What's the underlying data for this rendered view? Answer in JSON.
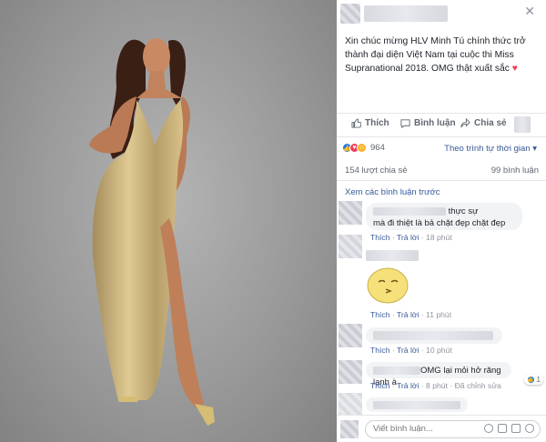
{
  "post": {
    "text": "Xin chúc mừng HLV Minh Tú chính thức trở thành đại diện Việt Nam tại cuộc thi Miss Supranational 2018. OMG thật xuất sắc ",
    "heart": "♥"
  },
  "actions": {
    "like": "Thích",
    "comment": "Bình luận",
    "share": "Chia sẻ"
  },
  "reactions": {
    "count": "964",
    "sort_label": "Theo trình tự thời gian ▾"
  },
  "stats": {
    "shares": "154 lượt chia sẻ",
    "comments": "99 bình luận"
  },
  "view_more": "Xem các bình luận trước",
  "comments": [
    {
      "text_after_blur": "thực sự",
      "text_line2": "mà đi thiệt là bả chặt đẹp chặt đẹp",
      "like": "Thích",
      "reply": "Trả lời",
      "time": "18 phút"
    },
    {
      "like": "Thích",
      "reply": "Trả lời",
      "time": "11 phút"
    },
    {
      "like": "Thích",
      "reply": "Trả lời",
      "time": "10 phút"
    },
    {
      "text_after_blur": "OMG lại mỏi hở răng lạnh à",
      "like": "Thích",
      "reply": "Trả lời",
      "time": "8 phút",
      "edited": "Đã chỉnh sửa",
      "reaction_count": "1"
    }
  ],
  "input": {
    "placeholder": "Viết bình luận..."
  },
  "colors": {
    "link": "#385898",
    "text": "#1d2129",
    "muted": "#606770",
    "like_blue": "#1877f2",
    "love_red": "#f33e58",
    "haha_yellow": "#f7b125"
  },
  "icons": [
    "close-icon",
    "like-icon",
    "comment-icon",
    "share-icon",
    "emoji-icon",
    "camera-icon",
    "gif-icon",
    "sticker-icon"
  ]
}
